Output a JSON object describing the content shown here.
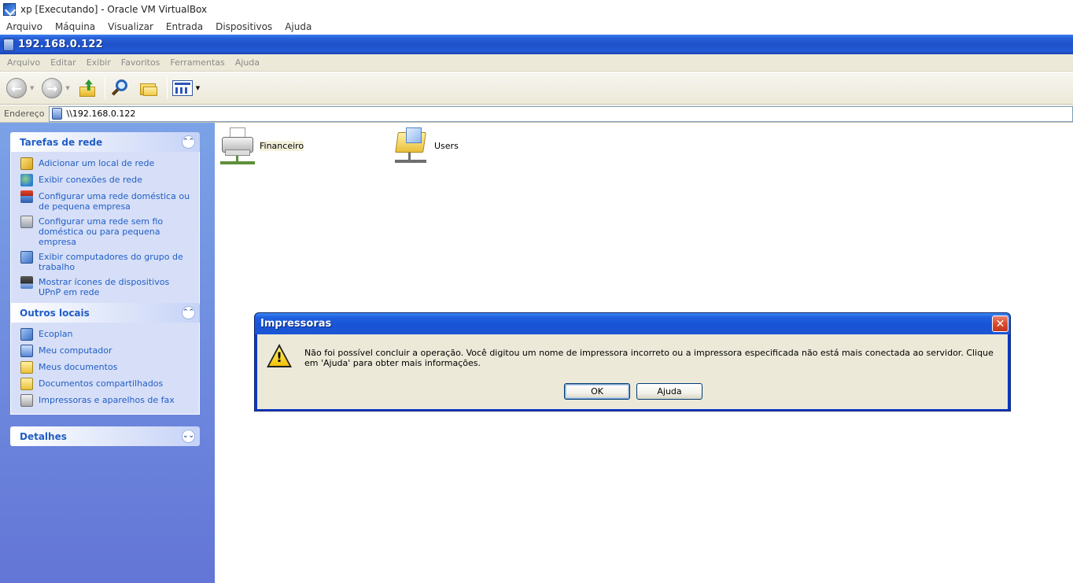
{
  "host": {
    "title": "xp [Executando] - Oracle VM VirtualBox",
    "menu": [
      "Arquivo",
      "Máquina",
      "Visualizar",
      "Entrada",
      "Dispositivos",
      "Ajuda"
    ]
  },
  "window": {
    "title": "192.168.0.122",
    "menu": [
      "Arquivo",
      "Editar",
      "Exibir",
      "Favoritos",
      "Ferramentas",
      "Ajuda"
    ],
    "toolbar_icons": [
      "back-arrow-icon",
      "forward-arrow-icon",
      "up-folder-icon",
      "search-icon",
      "folders-icon",
      "views-icon"
    ],
    "address_label": "Endereço",
    "address_value": "\\\\192.168.0.122"
  },
  "taskpane": {
    "network_tasks": {
      "title": "Tarefas de rede",
      "items": [
        {
          "label": "Adicionar um local de rede",
          "icon": "add-network-place-icon"
        },
        {
          "label": "Exibir conexões de rede",
          "icon": "network-connections-icon"
        },
        {
          "label": "Configurar uma rede doméstica ou de pequena empresa",
          "icon": "home-network-icon"
        },
        {
          "label": "Configurar uma rede sem fio doméstica ou para pequena empresa",
          "icon": "wireless-network-icon"
        },
        {
          "label": "Exibir computadores do grupo de trabalho",
          "icon": "workgroup-icon"
        },
        {
          "label": "Mostrar ícones de dispositivos UPnP em rede",
          "icon": "upnp-icon"
        }
      ]
    },
    "other_places": {
      "title": "Outros locais",
      "items": [
        {
          "label": "Ecoplan",
          "icon": "network-icon"
        },
        {
          "label": "Meu computador",
          "icon": "my-computer-icon"
        },
        {
          "label": "Meus documentos",
          "icon": "my-documents-icon"
        },
        {
          "label": "Documentos compartilhados",
          "icon": "shared-documents-icon"
        },
        {
          "label": "Impressoras e aparelhos de fax",
          "icon": "printers-icon"
        }
      ]
    },
    "details": {
      "title": "Detalhes"
    }
  },
  "content": {
    "items": [
      {
        "label": "Financeiro",
        "icon": "shared-printer-icon"
      },
      {
        "label": "Users",
        "icon": "shared-folder-icon"
      }
    ]
  },
  "dialog": {
    "title": "Impressoras",
    "message": "Não foi possível concluir a operação. Você digitou um nome de impressora incorreto ou a impressora especificada não está mais conectada ao servidor. Clique em 'Ajuda' para obter mais informações.",
    "ok_label": "OK",
    "help_label": "Ajuda",
    "icon": "warning-icon"
  }
}
